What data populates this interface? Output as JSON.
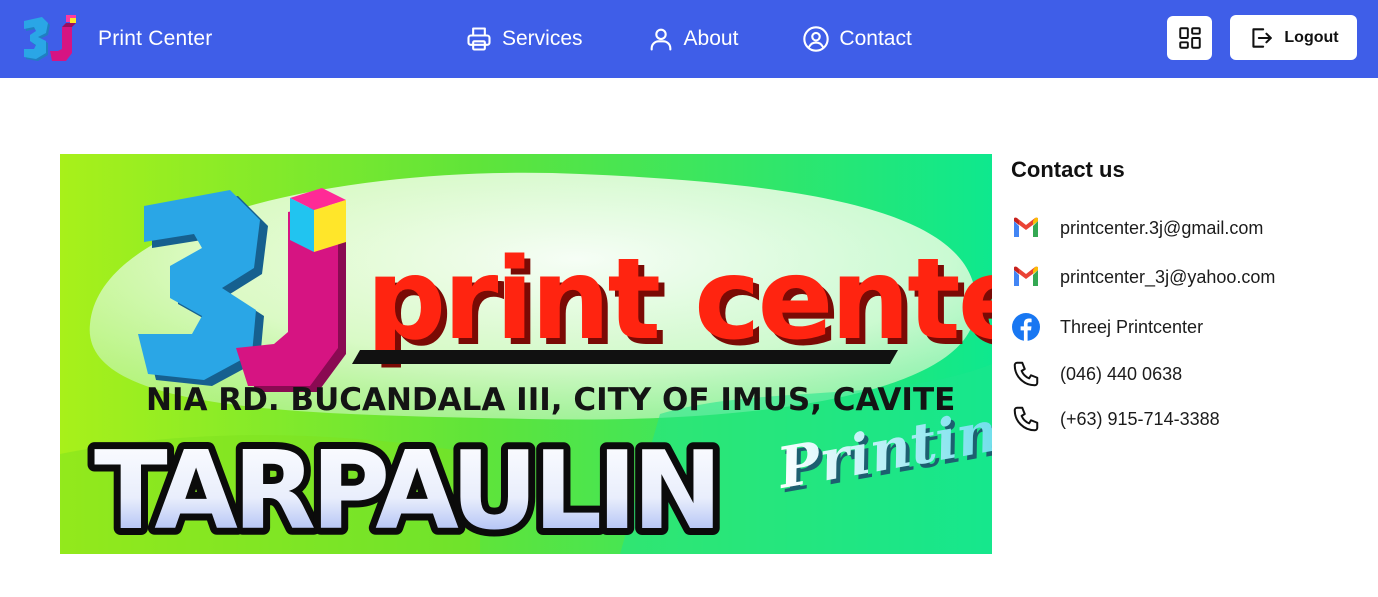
{
  "header": {
    "brand_name": "Print Center",
    "brand_logo_text": "3J",
    "nav": [
      {
        "label": "Services",
        "icon": "printer-icon"
      },
      {
        "label": "About",
        "icon": "user-icon"
      },
      {
        "label": "Contact",
        "icon": "user-circle-icon"
      }
    ],
    "grid_icon": "grid-icon",
    "logout_label": "Logout",
    "logout_icon": "logout-icon",
    "bg_color": "#3f5ee8"
  },
  "banner": {
    "logo_text": "3J",
    "headline": "print center",
    "address": "NIA RD. BUCANDALA III, CITY OF IMUS, CAVITE",
    "big_word": "TARPAULIN",
    "script_word": "Printing",
    "colors": {
      "headline": "#ff1a0a",
      "logo_blue": "#29a3e0",
      "logo_magenta": "#d61482",
      "bg_left": "#8fe81a",
      "bg_right": "#12e89a"
    }
  },
  "contact": {
    "title": "Contact us",
    "items": [
      {
        "icon": "gmail-icon",
        "text": "printcenter.3j@gmail.com"
      },
      {
        "icon": "gmail-icon",
        "text": "printcenter_3j@yahoo.com"
      },
      {
        "icon": "facebook-icon",
        "text": "Threej Printcenter"
      },
      {
        "icon": "phone-icon",
        "text": "(046) 440 0638"
      },
      {
        "icon": "phone-icon",
        "text": "(+63) 915-714-3388"
      }
    ]
  }
}
